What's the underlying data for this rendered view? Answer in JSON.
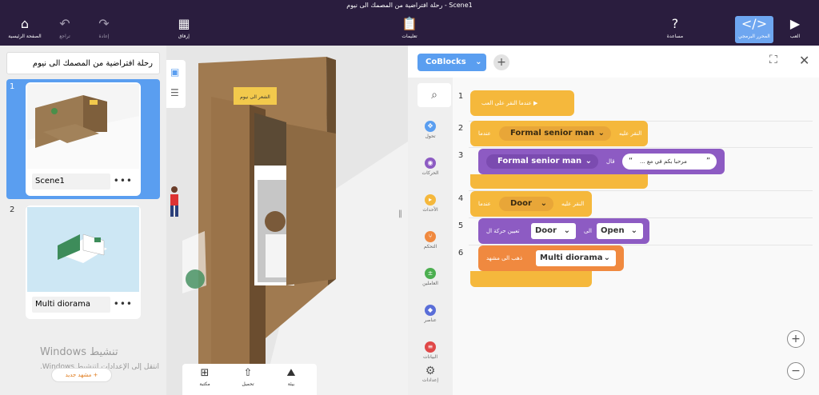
{
  "document_title": "رحلة افتراضية من المصمك الى نيوم - Scene1",
  "toolbar": {
    "home": "الصفحة الرئيسية",
    "undo": "تراجع",
    "redo": "إعادة",
    "library": "إرفاق",
    "instructions": "تعليمات",
    "help": "مساعدة",
    "code_editor": "المحرر البرمجي",
    "play": "العب"
  },
  "project_title": "رحلة افتراضية من المصمك الى نيوم",
  "scenes": [
    {
      "number": "1",
      "name": "Scene1",
      "more": "•••"
    },
    {
      "number": "2",
      "name": "Multi diorama",
      "more": "•••"
    }
  ],
  "add_scene": "مشهد جديد +",
  "watermark": {
    "line1": "تنشيط Windows",
    "line2": "انتقل إلى الإعدادات لتنشيط Windows."
  },
  "viewport": {
    "sign_text": "الشعر الى نيوم",
    "bottom": {
      "library": "مكتبة",
      "upload": "تحميل",
      "environment": "بيئة"
    }
  },
  "code": {
    "tab_label": "CoBlocks",
    "categories": [
      {
        "label": "تحول",
        "color": "#5a9ef0"
      },
      {
        "label": "الحركات",
        "color": "#8d5bc3"
      },
      {
        "label": "الأحداث",
        "color": "#f5b83c"
      },
      {
        "label": "التحكم",
        "color": "#f0893f"
      },
      {
        "label": "العاملين",
        "color": "#4caf50"
      },
      {
        "label": "عناصر",
        "color": "#5a6ed8"
      },
      {
        "label": "البيانات",
        "color": "#e04848"
      }
    ],
    "settings": "إعدادات",
    "lines": [
      "1",
      "2",
      "3",
      "4",
      "5",
      "6"
    ],
    "blocks": {
      "when_play": "▶ عندما النقر على العب",
      "when1": "عندما",
      "click_on1": "النقر عليه",
      "actor1": "Formal senior man",
      "actor2": "Formal senior man",
      "say": "قال",
      "speech": "مرحبا بكم في مع ...",
      "quote_open": "“",
      "quote_close": "”",
      "when2": "عندما",
      "click_on2": "النقر عليه",
      "door": "Door",
      "set_anim": "تعيين حركة ال",
      "door2": "Door",
      "to": "الى",
      "open": "Open",
      "goto_scene": "ذهب الى مشهد",
      "scene_target": "Multi diorama"
    }
  }
}
